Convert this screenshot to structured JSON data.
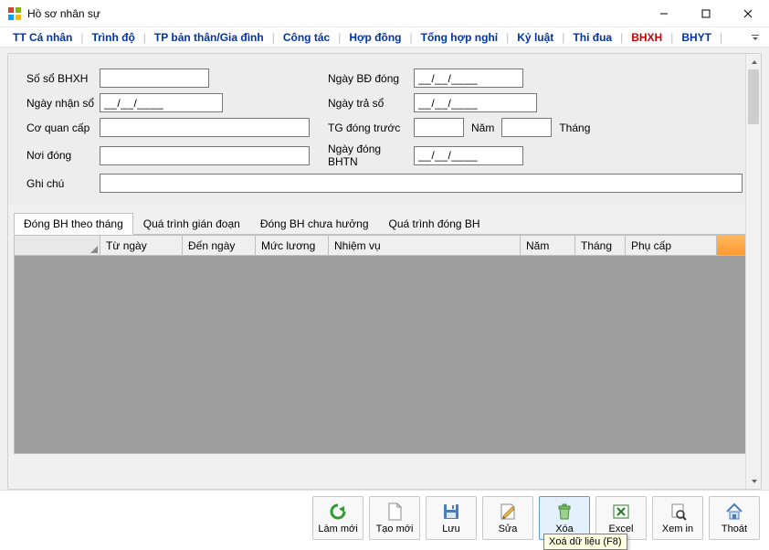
{
  "window": {
    "title": "Hồ sơ nhân sự"
  },
  "mainTabs": {
    "items": [
      {
        "label": "TT Cá nhân",
        "active": false
      },
      {
        "label": "Trình độ",
        "active": false
      },
      {
        "label": "TP bản thân/Gia đình",
        "active": false
      },
      {
        "label": "Công tác",
        "active": false
      },
      {
        "label": "Hợp đồng",
        "active": false
      },
      {
        "label": "Tổng hợp nghỉ",
        "active": false
      },
      {
        "label": "Kỷ luật",
        "active": false
      },
      {
        "label": "Thi đua",
        "active": false
      },
      {
        "label": "BHXH",
        "active": true
      },
      {
        "label": "BHYT",
        "active": false
      }
    ]
  },
  "form": {
    "soBhxhLabel": "Số sổ BHXH",
    "soBhxhValue": "",
    "ngayNhanSoLabel": "Ngày nhận sổ",
    "ngayNhanSoValue": "__/__/____",
    "coQuanCapLabel": "Cơ quan cấp",
    "coQuanCapValue": "",
    "noiDongLabel": "Nơi đóng",
    "noiDongValue": "",
    "ngayBdLabel": "Ngày BĐ đóng",
    "ngayBdValue": "__/__/____",
    "ngayTraSoLabel": "Ngày trả sổ",
    "ngayTraSoValue": "__/__/____",
    "tgDongTruocLabel": "TG đóng trước",
    "tgNamValue": "",
    "tgNamLabel": "Năm",
    "tgThangValue": "",
    "tgThangLabel": "Tháng",
    "ngayDongBhtnLabel": "Ngày đóng BHTN",
    "ngayDongBhtnValue": "__/__/____",
    "ghiChuLabel": "Ghi chú",
    "ghiChuValue": ""
  },
  "subTabs": {
    "items": [
      {
        "label": "Đóng BH theo tháng",
        "active": true
      },
      {
        "label": "Quá trình gián đoạn",
        "active": false
      },
      {
        "label": "Đóng BH chưa hưởng",
        "active": false
      },
      {
        "label": "Quá trình đóng BH",
        "active": false
      }
    ]
  },
  "grid": {
    "columns": [
      "Từ ngày",
      "Đến ngày",
      "Mức lương",
      "Nhiệm vụ",
      "Năm",
      "Tháng",
      "Phụ cấp"
    ]
  },
  "toolbar": {
    "refresh": "Làm mới",
    "new": "Tạo mới",
    "save": "Lưu",
    "edit": "Sửa",
    "delete": "Xóa",
    "excel": "Excel",
    "preview": "Xem in",
    "exit": "Thoát"
  },
  "tooltip": {
    "deleteTip": "Xoá dữ liệu (F8)"
  }
}
